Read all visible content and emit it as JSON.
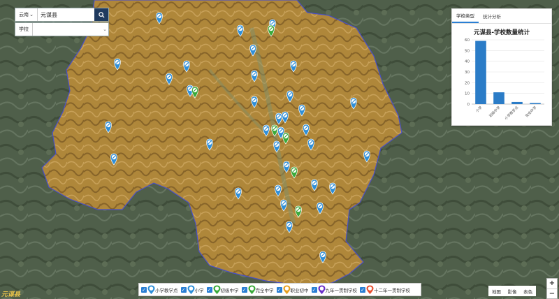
{
  "search": {
    "province_label": "云南",
    "query_value": "元谋县",
    "search_icon": "search-icon"
  },
  "school_filter": {
    "label": "学校",
    "selected": ""
  },
  "stats_panel": {
    "tabs": [
      {
        "label": "学校类型",
        "active": true
      },
      {
        "label": "统计分析",
        "active": false
      }
    ]
  },
  "chart_data": {
    "type": "bar",
    "title": "元谋县-学校数量统计",
    "categories": [
      "小学",
      "初级中学",
      "小学教学点",
      "完全中学"
    ],
    "values": [
      59,
      11,
      2,
      1
    ],
    "ylim": [
      0,
      60
    ],
    "yticks": [
      0,
      10,
      20,
      30,
      40,
      50,
      60
    ],
    "grid": true,
    "color": "#2b7cc7"
  },
  "legend": {
    "items": [
      {
        "label": "小学教学点",
        "icon": "school-pin-icon",
        "color": "#2f8fd8",
        "checked": true
      },
      {
        "label": "小学",
        "icon": "school-pin-icon",
        "color": "#2f8fd8",
        "checked": true
      },
      {
        "label": "初级中学",
        "icon": "school-pin-icon",
        "color": "#3aaa3a",
        "checked": true
      },
      {
        "label": "完全中学",
        "icon": "school-pin-icon",
        "color": "#3aaa3a",
        "checked": true
      },
      {
        "label": "职业初中",
        "icon": "school-pin-icon",
        "color": "#e8a020",
        "checked": true
      },
      {
        "label": "九年一贯制学校",
        "icon": "school-pin-icon",
        "color": "#6a2fc8",
        "checked": true
      },
      {
        "label": "十二年一贯制学校",
        "icon": "school-pin-icon",
        "color": "#e85030",
        "checked": true
      }
    ]
  },
  "basemap": {
    "options": [
      "地图",
      "影像",
      "表色"
    ]
  },
  "zoom": {
    "in": "+",
    "out": "−"
  },
  "watermark": "元谋县"
}
